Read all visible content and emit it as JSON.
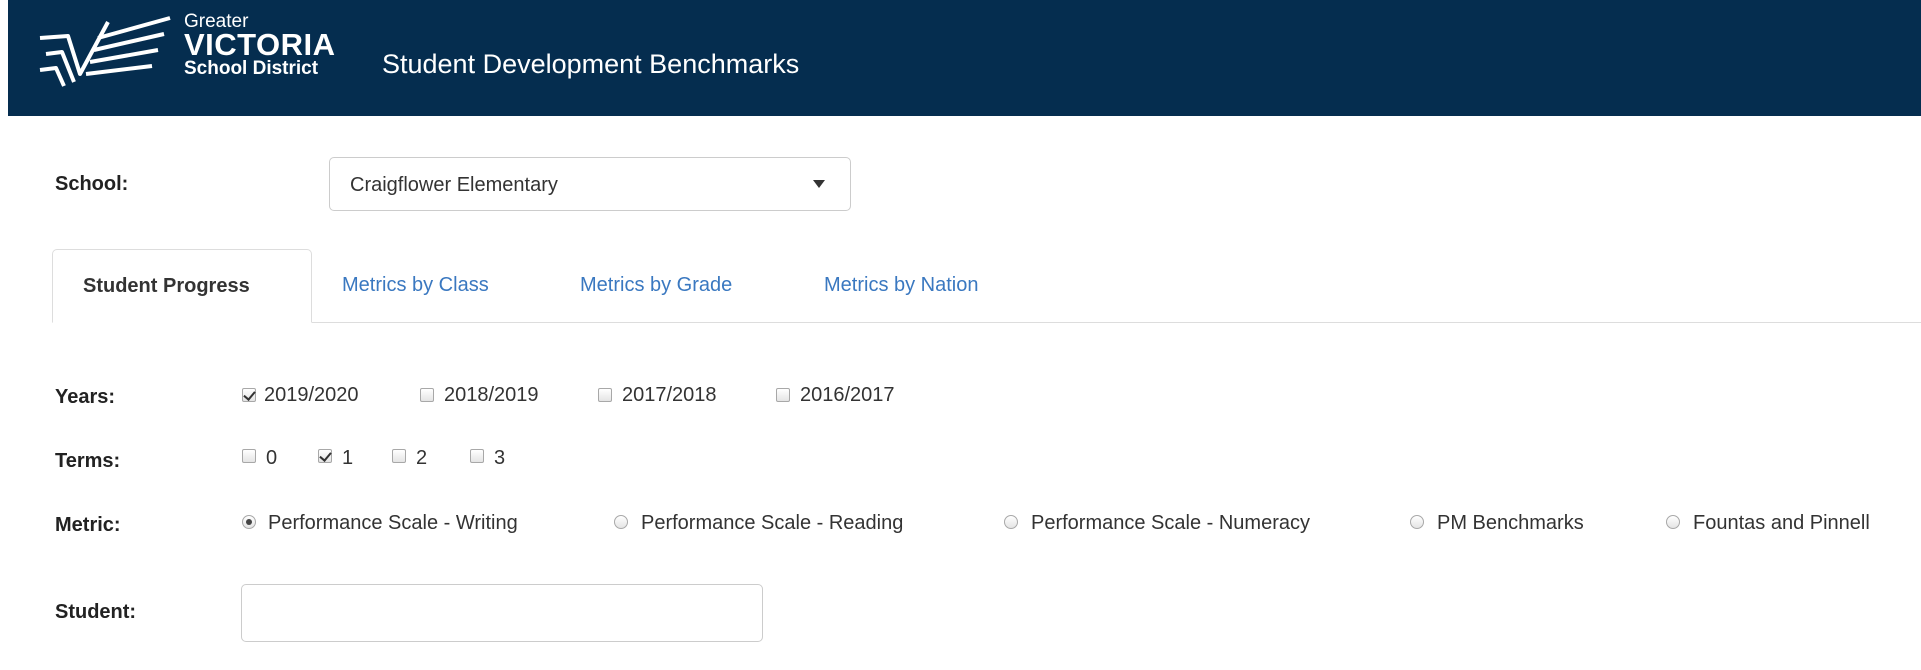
{
  "header": {
    "logo": {
      "line1": "Greater",
      "line2": "VICTORIA",
      "line3": "School District"
    },
    "title": "Student Development Benchmarks",
    "background": "#052d4f"
  },
  "school": {
    "label": "School:",
    "selected": "Craigflower Elementary"
  },
  "tabs": [
    {
      "label": "Student Progress",
      "active": true
    },
    {
      "label": "Metrics by Class",
      "active": false
    },
    {
      "label": "Metrics by Grade",
      "active": false
    },
    {
      "label": "Metrics by Nation",
      "active": false
    }
  ],
  "years": {
    "label": "Years:",
    "options": [
      {
        "label": "2019/2020",
        "checked": true
      },
      {
        "label": "2018/2019",
        "checked": false
      },
      {
        "label": "2017/2018",
        "checked": false
      },
      {
        "label": "2016/2017",
        "checked": false
      }
    ]
  },
  "terms": {
    "label": "Terms:",
    "options": [
      {
        "label": "0",
        "checked": false
      },
      {
        "label": "1",
        "checked": true
      },
      {
        "label": "2",
        "checked": false
      },
      {
        "label": "3",
        "checked": false
      }
    ]
  },
  "metric": {
    "label": "Metric:",
    "options": [
      {
        "label": "Performance Scale - Writing",
        "selected": true
      },
      {
        "label": "Performance Scale - Reading",
        "selected": false
      },
      {
        "label": "Performance Scale - Numeracy",
        "selected": false
      },
      {
        "label": "PM Benchmarks",
        "selected": false
      },
      {
        "label": "Fountas and Pinnell",
        "selected": false
      }
    ]
  },
  "student": {
    "label": "Student:",
    "value": ""
  },
  "colors": {
    "link": "#3a78c0",
    "header": "#052d4f"
  }
}
